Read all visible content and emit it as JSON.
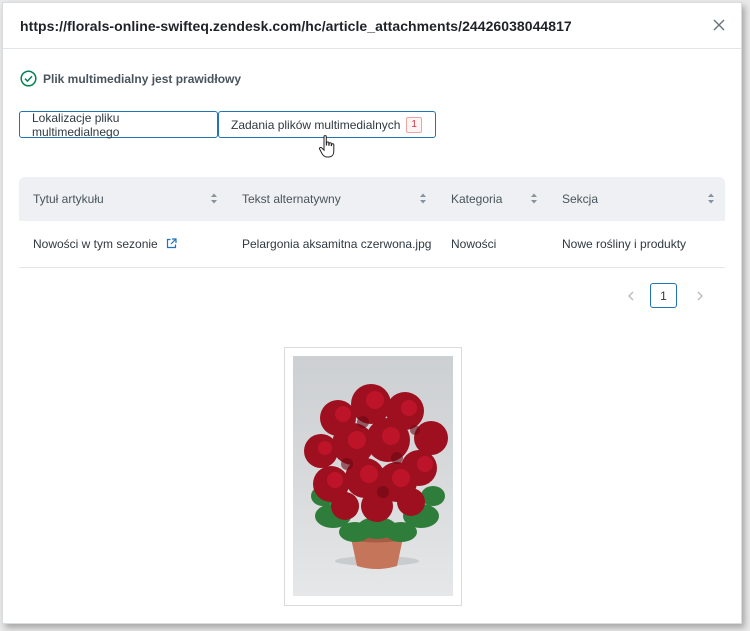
{
  "header": {
    "url": "https://florals-online-swifteq.zendesk.com/hc/article_attachments/24426038044817"
  },
  "status": {
    "message": "Plik multimedialny jest prawidłowy"
  },
  "tabs": [
    {
      "label": "Lokalizacje pliku multimedialnego"
    },
    {
      "label": "Zadania plików multimedialnych",
      "badge": "1"
    }
  ],
  "table": {
    "columns": [
      "Tytuł artykułu",
      "Tekst alternatywny",
      "Kategoria",
      "Sekcja"
    ],
    "rows": [
      {
        "title": "Nowości w tym sezonie",
        "alt": "Pelargonia aksamitna czerwona.jpg",
        "category": "Nowości",
        "section": "Nowe rośliny i produkty"
      }
    ]
  },
  "pagination": {
    "current": "1"
  },
  "colors": {
    "accent": "#1f73b7",
    "success": "#038153",
    "badge": "#cc3340"
  }
}
